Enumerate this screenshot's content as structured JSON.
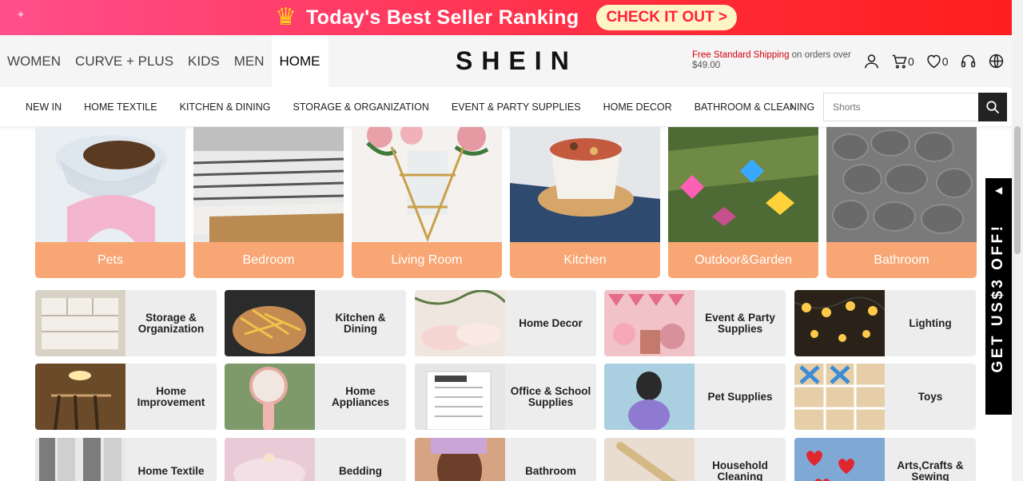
{
  "promo": {
    "icon": "crown-icon",
    "title": "Today's Best Seller Ranking",
    "cta": "CHECK IT OUT >"
  },
  "header": {
    "categories": [
      "WOMEN",
      "CURVE + PLUS",
      "KIDS",
      "MEN",
      "HOME"
    ],
    "active_category": "HOME",
    "logo": "SHEIN",
    "shipping_highlight": "Free Standard Shipping",
    "shipping_rest": " on orders over $49.00",
    "cart_count": "0",
    "wishlist_count": "0",
    "icons": [
      "user-icon",
      "cart-icon",
      "heart-icon",
      "headset-icon",
      "globe-icon"
    ]
  },
  "subnav": {
    "items": [
      "NEW IN",
      "HOME TEXTILE",
      "KITCHEN & DINING",
      "STORAGE & ORGANIZATION",
      "EVENT & PARTY SUPPLIES",
      "HOME DECOR",
      "BATHROOM & CLEANING"
    ],
    "prev": "‹",
    "next": "›",
    "search_placeholder": "Shorts"
  },
  "tiles": [
    "Pets",
    "Bedroom",
    "Living Room",
    "Kitchen",
    "Outdoor&Garden",
    "Bathroom"
  ],
  "cards": [
    [
      "Storage & Organization",
      "Kitchen & Dining",
      "Home Decor",
      "Event & Party Supplies",
      "Lighting"
    ],
    [
      "Home Improvement",
      "Home Appliances",
      "Office & School Supplies",
      "Pet Supplies",
      "Toys"
    ],
    [
      "Home Textile",
      "Bedding",
      "Bathroom",
      "Household Cleaning",
      "Arts,Crafts & Sewing"
    ]
  ],
  "coupon": {
    "text": "GET US$3 OFF!",
    "arrow": "◀"
  },
  "colors": {
    "accent": "#f8a673",
    "promo_red": "#ff2a35",
    "card_bg": "#ededed"
  }
}
